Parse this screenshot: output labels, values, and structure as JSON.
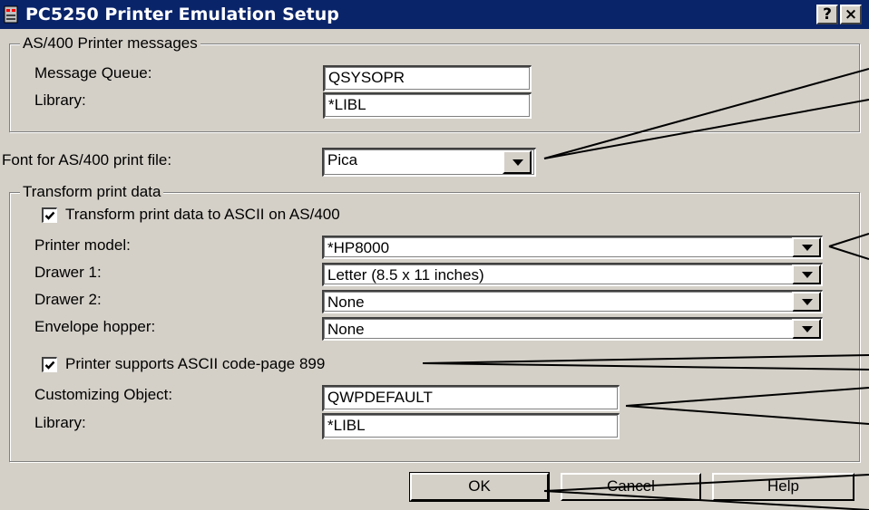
{
  "window": {
    "title": "PC5250 Printer Emulation Setup",
    "help_glyph": "?",
    "close_glyph": "×"
  },
  "printer_messages": {
    "legend": "AS/400 Printer messages",
    "message_queue_label": "Message Queue:",
    "message_queue_value": "QSYSOPR",
    "library_label": "Library:",
    "library_value": "*LIBL"
  },
  "font": {
    "label": "Font for AS/400 print file:",
    "value": "Pica"
  },
  "transform": {
    "legend": "Transform print data",
    "transform_checkbox_label": "Transform print data to ASCII on AS/400",
    "transform_checked": true,
    "printer_model_label": "Printer model:",
    "printer_model_value": "*HP8000",
    "drawer1_label": "Drawer 1:",
    "drawer1_value": "Letter (8.5 x 11 inches)",
    "drawer2_label": "Drawer 2:",
    "drawer2_value": "None",
    "envelope_label": "Envelope hopper:",
    "envelope_value": "None",
    "codepage_checkbox_label": "Printer supports ASCII code-page 899",
    "codepage_checked": true,
    "customizing_label": "Customizing Object:",
    "customizing_value": "QWPDEFAULT",
    "custom_library_label": "Library:",
    "custom_library_value": "*LIBL"
  },
  "buttons": {
    "ok": "OK",
    "cancel": "Cancel",
    "help": "Help"
  },
  "icons": {
    "app": "printer-app-icon",
    "dropdown": "chevron-down-icon",
    "check": "checkmark-icon"
  },
  "colors": {
    "titlebar": "#0a246a",
    "dialog_face": "#d4d0c8",
    "field_background": "#ffffff"
  }
}
